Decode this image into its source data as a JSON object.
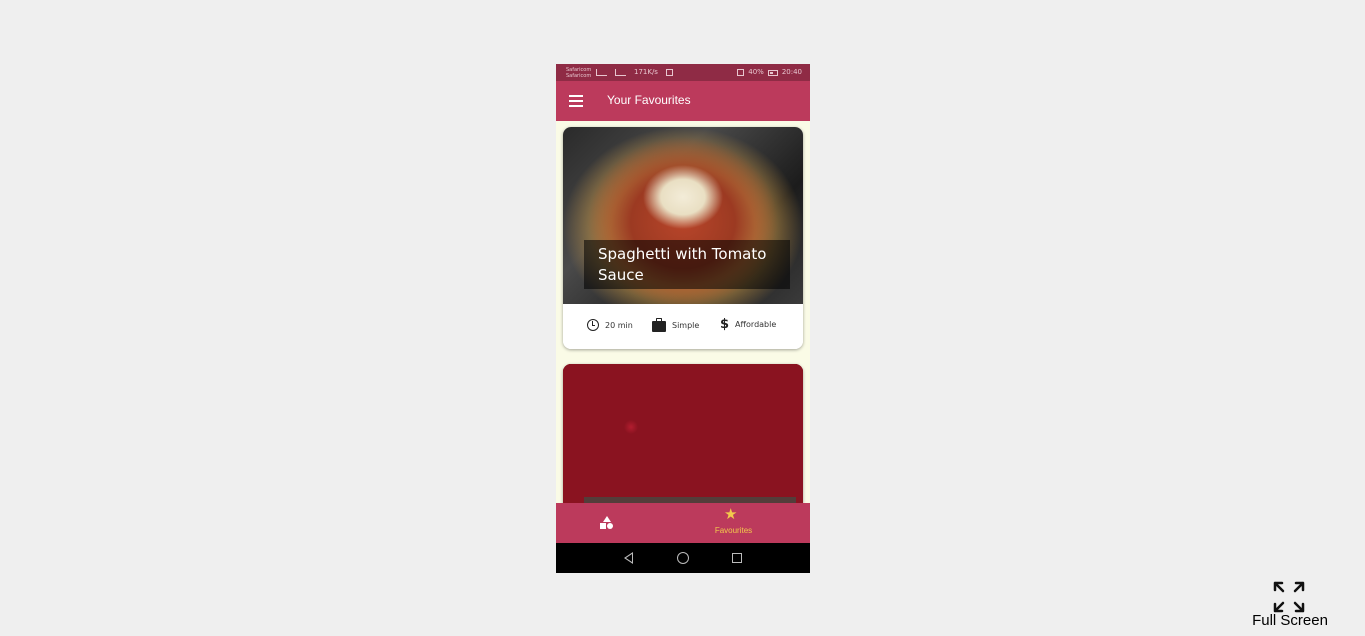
{
  "status_bar": {
    "carrier": "Safaricom Safaricom",
    "speed": "171K/s",
    "battery": "40%",
    "time": "20:40"
  },
  "app_bar": {
    "title": "Your Favourites",
    "menu_icon": "menu-icon"
  },
  "meals": [
    {
      "title": "Spaghetti with Tomato Sauce",
      "duration": "20 min",
      "complexity": "Simple",
      "affordability": "Affordable"
    },
    {
      "title": ""
    }
  ],
  "bottom_nav": {
    "categories_icon": "category-shapes-icon",
    "favourites_label": "Favourites",
    "favourites_icon": "star-icon",
    "active_color": "#f2c94c",
    "bar_color": "#bc3a5c"
  },
  "system_nav": {
    "back_icon": "back-icon",
    "home_icon": "home-icon",
    "recents_icon": "recents-icon"
  },
  "fullscreen": {
    "label": "Full Screen"
  }
}
